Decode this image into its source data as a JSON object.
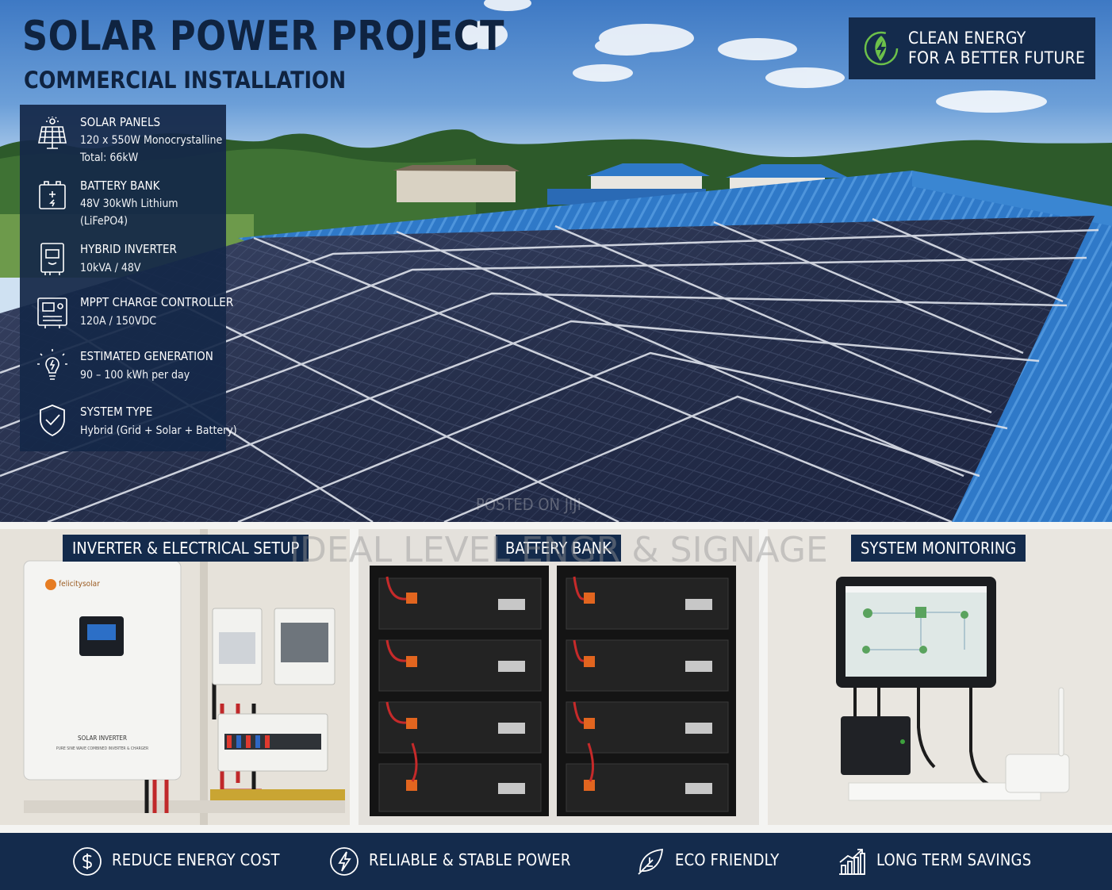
{
  "header": {
    "title": "SOLAR POWER PROJECT",
    "subtitle": "COMMERCIAL INSTALLATION"
  },
  "badge": {
    "line1": "CLEAN ENERGY",
    "line2": "FOR A BETTER FUTURE",
    "icon": "leaf-bolt-icon",
    "accent": "#6cc04a"
  },
  "specs": [
    {
      "icon": "solar-panel-icon",
      "title": "SOLAR PANELS",
      "lines": [
        "120 x 550W Monocrystalline",
        "Total: 66kW"
      ]
    },
    {
      "icon": "battery-icon",
      "title": "BATTERY BANK",
      "lines": [
        "48V 30kWh Lithium",
        "(LiFePO4)"
      ]
    },
    {
      "icon": "inverter-icon",
      "title": "HYBRID INVERTER",
      "lines": [
        "10kVA / 48V"
      ]
    },
    {
      "icon": "charge-controller-icon",
      "title": "MPPT CHARGE CONTROLLER",
      "lines": [
        "120A / 150VDC"
      ]
    },
    {
      "icon": "lightbulb-icon",
      "title": "ESTIMATED GENERATION",
      "lines": [
        "90 – 100 kWh per day"
      ]
    },
    {
      "icon": "shield-check-icon",
      "title": "SYSTEM TYPE",
      "lines": [
        "Hybrid (Grid + Solar + Battery)"
      ]
    }
  ],
  "photos": [
    {
      "label": "INVERTER & ELECTRICAL SETUP",
      "brand": "felicitysolar",
      "device_text": "SOLAR INVERTER",
      "device_subtext": "PURE SINE WAVE COMBINED INVERTER & CHARGER"
    },
    {
      "label": "BATTERY BANK"
    },
    {
      "label": "SYSTEM MONITORING"
    }
  ],
  "watermarks": {
    "main": "IDEAL LEVEL ENGR & SIGNAGE",
    "secondary": "POSTED ON JIJI"
  },
  "features": [
    {
      "icon": "dollar-icon",
      "label": "REDUCE ENERGY COST"
    },
    {
      "icon": "lightning-icon",
      "label": "RELIABLE & STABLE POWER"
    },
    {
      "icon": "leaf-icon",
      "label": "ECO FRIENDLY"
    },
    {
      "icon": "growth-chart-icon",
      "label": "LONG TERM SAVINGS"
    }
  ],
  "colors": {
    "navy": "#142b4c",
    "title": "#0f2340",
    "roof_blue": "#2f79c8",
    "panel": "#27314d"
  }
}
